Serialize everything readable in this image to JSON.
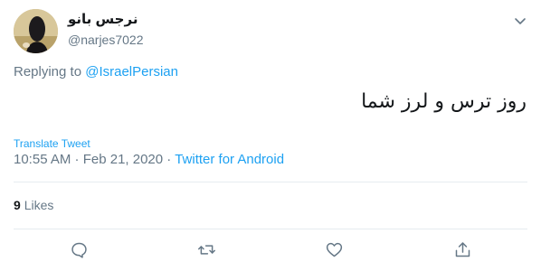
{
  "author": {
    "display_name": "نرجس بانو",
    "handle": "@narjes7022"
  },
  "reply": {
    "prefix": "Replying to",
    "mention": "@IsraelPersian"
  },
  "tweet": {
    "text": "روز ترس و لرز شما",
    "translate_label": "Translate Tweet",
    "timestamp": "10:55 AM · Feb 21, 2020",
    "separator": " · ",
    "source": "Twitter for Android"
  },
  "stats": {
    "likes_count": "9",
    "likes_label": "Likes"
  },
  "icons": {
    "caret": "chevron-down-icon",
    "reply": "reply-icon",
    "retweet": "retweet-icon",
    "like": "heart-icon",
    "share": "share-icon"
  },
  "colors": {
    "accent": "#1da1f2",
    "secondary_text": "#657786",
    "primary_text": "#14171a",
    "divider": "#e6ecf0"
  }
}
